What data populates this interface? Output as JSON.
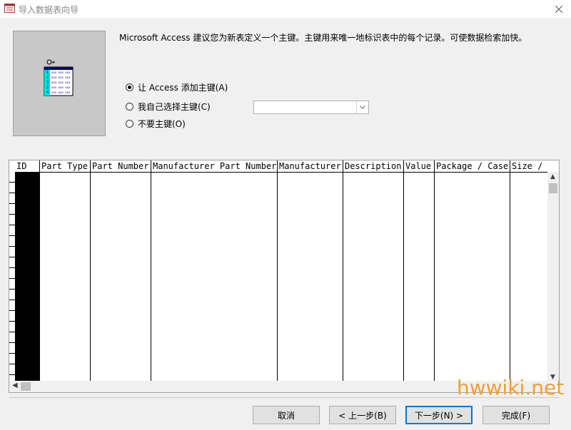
{
  "window": {
    "title": "导入数据表向导"
  },
  "description": "Microsoft Access 建议您为新表定义一个主键。主键用来唯一地标识表中的每个记录。可使数据检索加快。",
  "options": [
    {
      "label": "让 Access 添加主键(A)",
      "checked": true
    },
    {
      "label": "我自己选择主键(C)",
      "checked": false
    },
    {
      "label": "不要主键(O)",
      "checked": false
    }
  ],
  "key_select": {
    "value": ""
  },
  "preview_icon": {
    "rows": [
      "1",
      "2",
      "3",
      "2",
      "4"
    ],
    "cell_text": "xxx xxx xxx"
  },
  "grid": {
    "columns": [
      "ID",
      "Part Type",
      "Part Number",
      "Manufacturer Part Number",
      "Manufacturer",
      "Description",
      "Value",
      "Package / Case",
      "Size /"
    ],
    "selected_column": "ID"
  },
  "buttons": {
    "cancel": "取消",
    "back": "< 上一步(B)",
    "next": "下一步(N) >",
    "finish": "完成(F)"
  },
  "watermark": "hwwiki.net",
  "colors": {
    "accent": "#0078d7",
    "watermark": "#f0a030",
    "icon_highlight": "#00e0e0"
  }
}
